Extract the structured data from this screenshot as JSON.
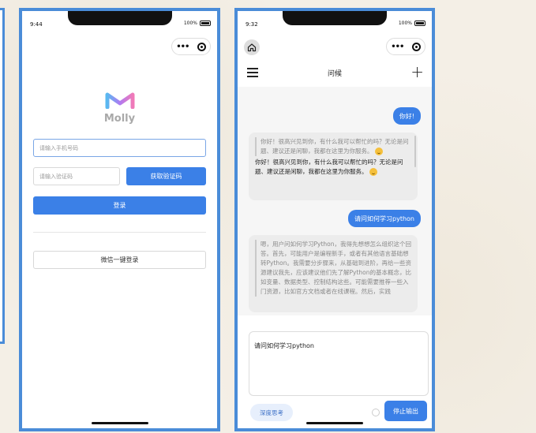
{
  "login_screen": {
    "status_time": "9:44",
    "battery": "100%",
    "logo_text": "Molly",
    "phone_placeholder": "请输入手机号码",
    "code_placeholder": "请输入验证码",
    "get_code_label": "获取验证码",
    "login_label": "登录",
    "wechat_login_label": "微信一键登录"
  },
  "chat_screen": {
    "status_time": "9:32",
    "battery": "100%",
    "title": "问候",
    "messages": {
      "user_1": "你好!",
      "ai_1_thinking": "你好！很高兴见到你，有什么我可以帮忙的吗？无论是问题、建议还是闲聊，我都在这里为你服务。",
      "ai_1_reply": "你好！很高兴见到你，有什么我可以帮忙的吗？无论是问题、建议还是闲聊，我都在这里为你服务。",
      "user_2": "请问如何学习python",
      "ai_2_thinking": "嗯，用户问如何学习Python，我得先想想怎么组织这个回答。首先，可能用户是编程新手，或者有其他语言基础想转Python。我需要分步骤来，从基础到进阶，再给一些资源建议我先，应该建议他们先了解Python的基本概念，比如变量、数据类型、控制结构这些。可能需要推荐一些入门资源，比如官方文档或者在线课程。然后，实践"
    },
    "input_text": "请问如何学习python",
    "deep_think_label": "深度思考",
    "stop_label": "停止输出"
  },
  "colors": {
    "accent": "#3b80e7",
    "frame": "#4a8cd8"
  }
}
